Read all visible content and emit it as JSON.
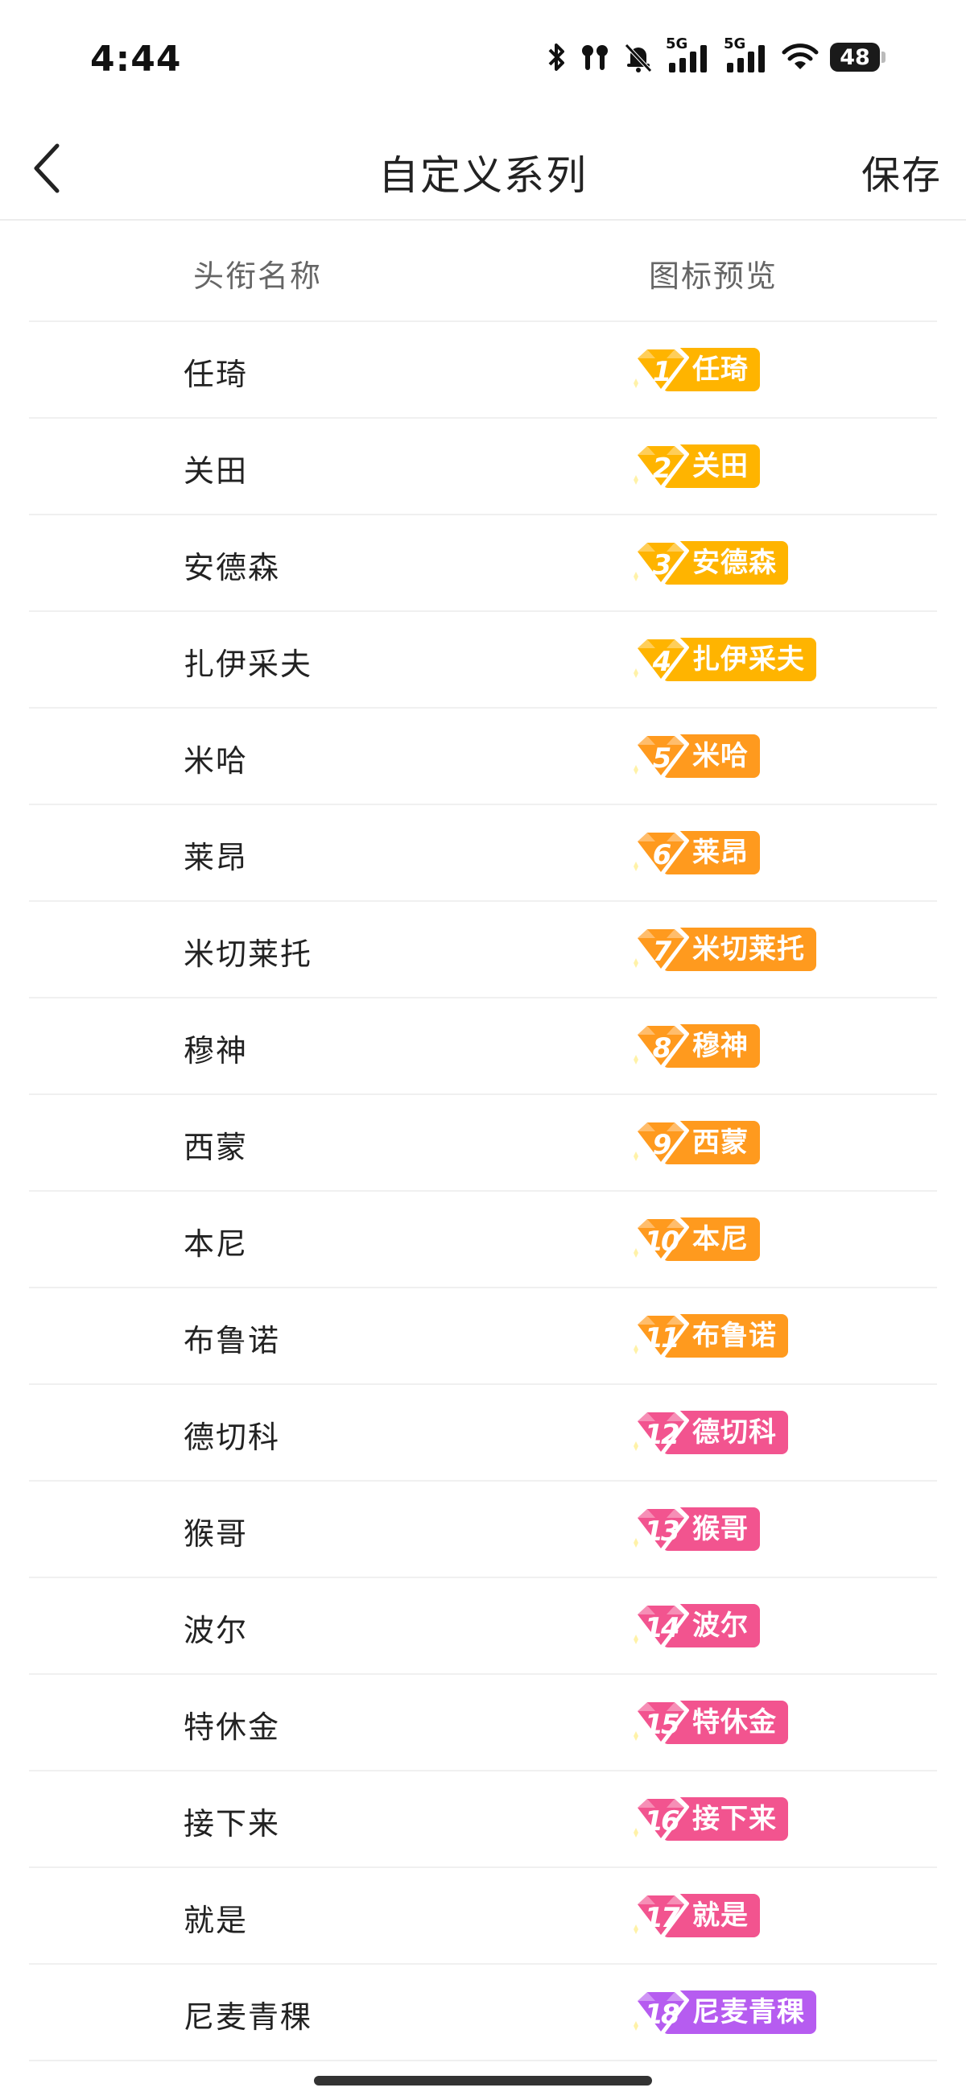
{
  "status": {
    "time": "4:44",
    "network1": "5G",
    "network2": "5G",
    "battery": "48"
  },
  "nav": {
    "title": "自定义系列",
    "save": "保存"
  },
  "table": {
    "header_name": "头衔名称",
    "header_preview": "图标预览"
  },
  "rows": [
    {
      "name": "任琦",
      "badge": "任琦",
      "level": "1",
      "color": "#FFB400"
    },
    {
      "name": "关田",
      "badge": "关田",
      "level": "2",
      "color": "#FFB400"
    },
    {
      "name": "安德森",
      "badge": "安德森",
      "level": "3",
      "color": "#FFB400"
    },
    {
      "name": "扎伊采夫",
      "badge": "扎伊采夫",
      "level": "4",
      "color": "#FFB400"
    },
    {
      "name": "米哈",
      "badge": "米哈",
      "level": "5",
      "color": "#FF9A1E"
    },
    {
      "name": "莱昂",
      "badge": "莱昂",
      "level": "6",
      "color": "#FF9A1E"
    },
    {
      "name": "米切莱托",
      "badge": "米切莱托",
      "level": "7",
      "color": "#FF9A1E"
    },
    {
      "name": "穆神",
      "badge": "穆神",
      "level": "8",
      "color": "#FF9A1E"
    },
    {
      "name": "西蒙",
      "badge": "西蒙",
      "level": "9",
      "color": "#FF9A1E"
    },
    {
      "name": "本尼",
      "badge": "本尼",
      "level": "10",
      "color": "#FF9A1E"
    },
    {
      "name": "布鲁诺",
      "badge": "布鲁诺",
      "level": "11",
      "color": "#FF9A1E"
    },
    {
      "name": "德切科",
      "badge": "德切科",
      "level": "12",
      "color": "#F2548F"
    },
    {
      "name": "猴哥",
      "badge": "猴哥",
      "level": "13",
      "color": "#F2548F"
    },
    {
      "name": "波尔",
      "badge": "波尔",
      "level": "14",
      "color": "#F2548F"
    },
    {
      "name": "特休金",
      "badge": "特休金",
      "level": "15",
      "color": "#F2548F"
    },
    {
      "name": "接下来",
      "badge": "接下来",
      "level": "16",
      "color": "#F2548F"
    },
    {
      "name": "就是",
      "badge": "就是",
      "level": "17",
      "color": "#F2548F"
    },
    {
      "name": "尼麦青稞",
      "badge": "尼麦青稞",
      "level": "18",
      "color": "#B65CF0"
    }
  ]
}
